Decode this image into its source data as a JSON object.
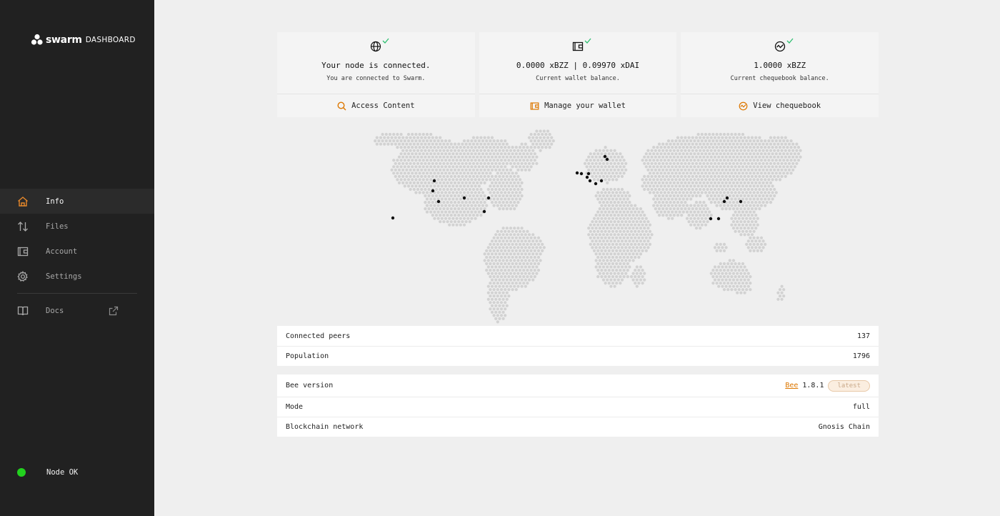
{
  "app": {
    "brand": "swarm",
    "subtitle": "DASHBOARD"
  },
  "nav": {
    "items": [
      {
        "label": "Info",
        "icon": "home-icon",
        "active": true
      },
      {
        "label": "Files",
        "icon": "transfer-arrows-icon",
        "active": false
      },
      {
        "label": "Account",
        "icon": "wallet-icon",
        "active": false
      },
      {
        "label": "Settings",
        "icon": "gear-icon",
        "active": false
      }
    ],
    "docs": {
      "label": "Docs",
      "icon": "book-icon",
      "ext_icon": "external-link-icon"
    }
  },
  "status": {
    "label": "Node OK",
    "color": "#22d11e"
  },
  "cards": [
    {
      "title": "Your node is connected.",
      "subtitle": "You are connected to Swarm.",
      "action": "Access Content",
      "icon": "globe-icon",
      "action_icon": "search-icon"
    },
    {
      "title": "0.0000 xBZZ | 0.09970 xDAI",
      "subtitle": "Current wallet balance.",
      "action": "Manage your wallet",
      "icon": "wallet-icon",
      "action_icon": "wallet-icon"
    },
    {
      "title": "1.0000 xBZZ",
      "subtitle": "Current chequebook balance.",
      "action": "View chequebook",
      "icon": "chequebook-icon",
      "action_icon": "chequebook-icon"
    }
  ],
  "peers_table": [
    {
      "label": "Connected peers",
      "value": "137"
    },
    {
      "label": "Population",
      "value": "1796"
    }
  ],
  "info_table": {
    "bee_version": {
      "label": "Bee version",
      "link": "Bee",
      "version": "1.8.1",
      "badge": "latest"
    },
    "mode": {
      "label": "Mode",
      "value": "full"
    },
    "network": {
      "label": "Blockchain network",
      "value": "Gnosis Chain"
    }
  },
  "colors": {
    "accent": "#dd7700",
    "sidebar": "#212121",
    "check": "#2fbf71"
  }
}
